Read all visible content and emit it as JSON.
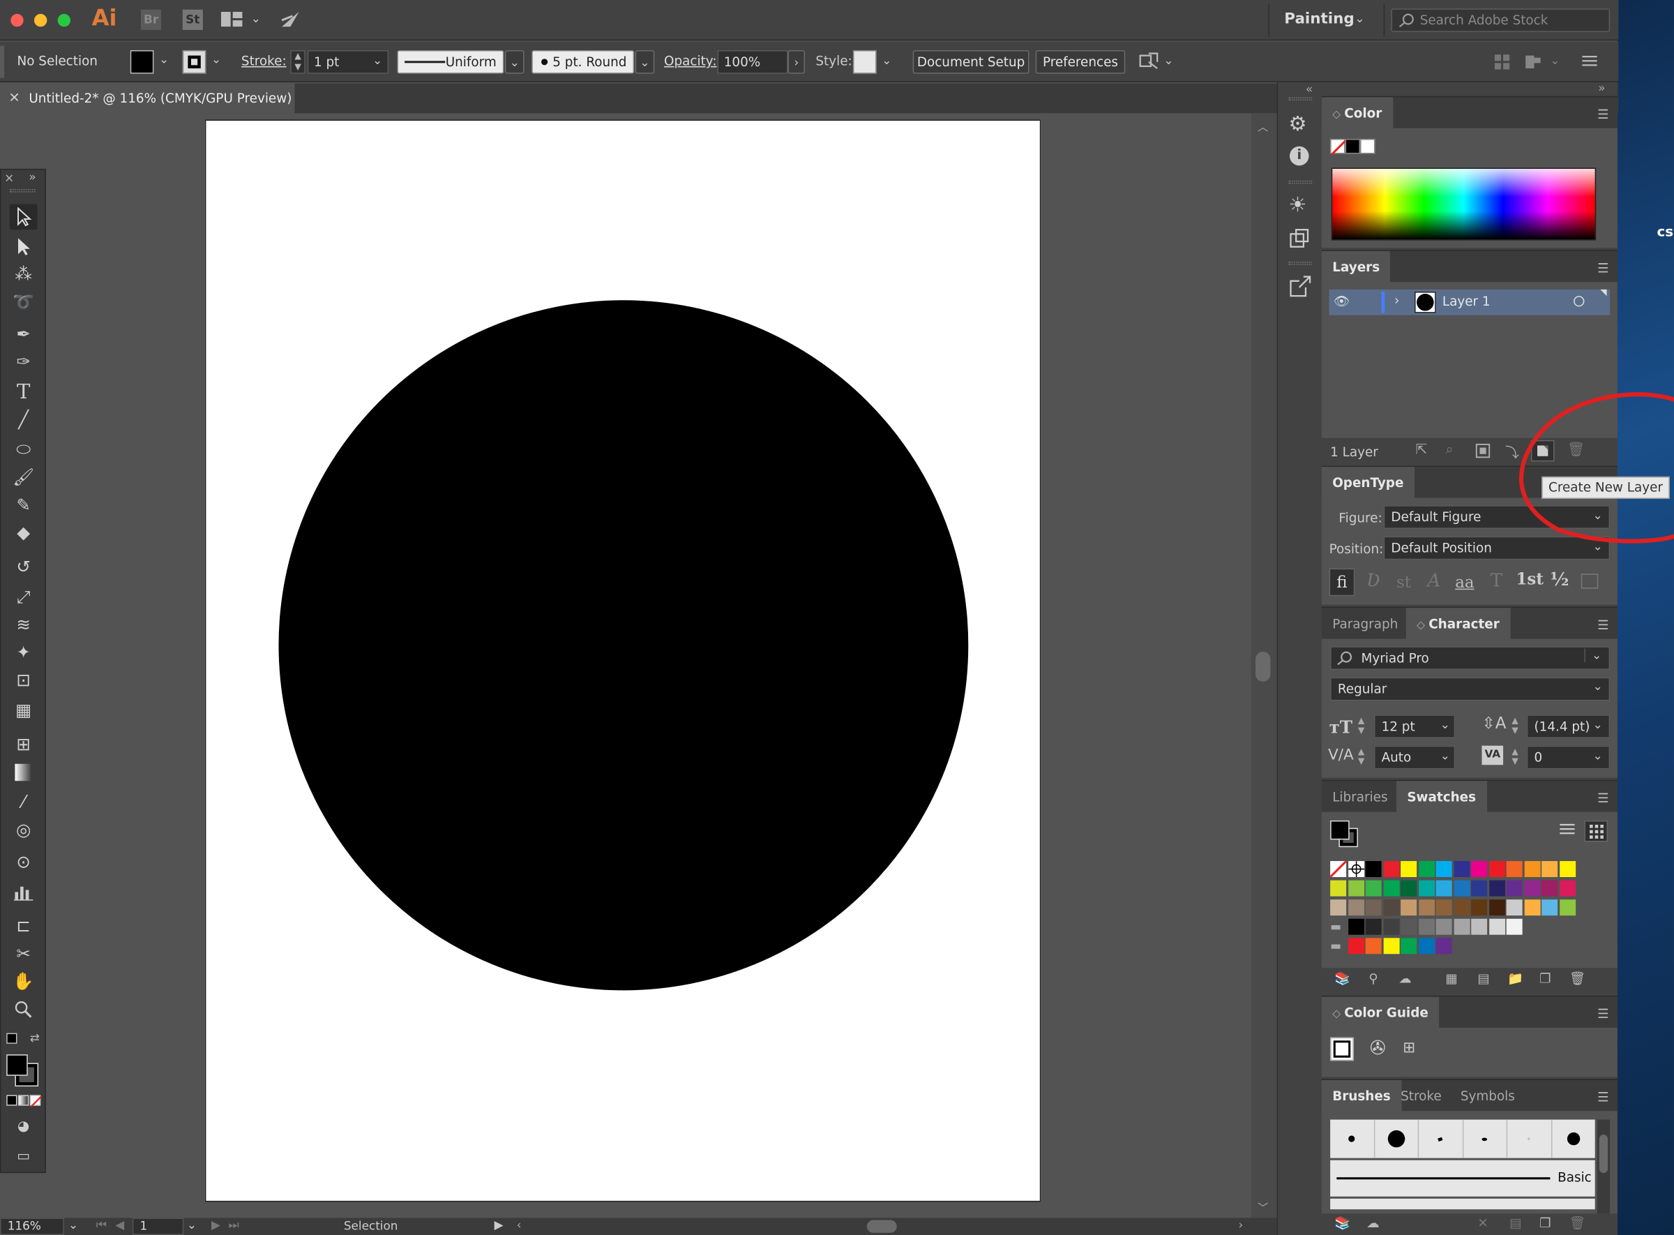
{
  "app": {
    "logo": "Ai",
    "bridge": "Br",
    "stock": "St",
    "workspace": "Painting",
    "search_placeholder": "Search Adobe Stock"
  },
  "control_bar": {
    "selection_status": "No Selection",
    "stroke_label": "Stroke:",
    "stroke_weight": "1 pt",
    "stroke_profile": "Uniform",
    "brush": "5 pt. Round",
    "opacity_label": "Opacity:",
    "opacity": "100%",
    "style_label": "Style:",
    "document_setup": "Document Setup",
    "preferences": "Preferences"
  },
  "document": {
    "tab_title": "Untitled-2* @ 116% (CMYK/GPU Preview)"
  },
  "status_bar": {
    "zoom": "116%",
    "artboard_number": "1",
    "status": "Selection"
  },
  "panels": {
    "color": {
      "title": "Color"
    },
    "layers": {
      "title": "Layers",
      "layer_name": "Layer 1",
      "count": "1 Layer",
      "tooltip": "Create New Layer"
    },
    "opentype": {
      "title": "OpenType",
      "figure_label": "Figure:",
      "figure": "Default Figure",
      "position_label": "Position:",
      "position": "Default Position",
      "glyphs": [
        "fi",
        "Ʋ",
        "st",
        "A",
        "aa",
        "T",
        "1st",
        "½"
      ]
    },
    "character": {
      "tab_paragraph": "Paragraph",
      "tab_character": "Character",
      "font": "Myriad Pro",
      "style": "Regular",
      "size": "12 pt",
      "leading": "(14.4 pt)",
      "kerning": "Auto",
      "tracking": "0"
    },
    "swatches": {
      "tab_libraries": "Libraries",
      "tab_swatches": "Swatches",
      "rows": [
        [
          "#ffffff",
          "#ffffff",
          "#000000",
          "#e8212c",
          "#fff200",
          "#00a651",
          "#00aeef",
          "#2e3192",
          "#ec008c",
          "#ed1c24",
          "#f26522",
          "#f7941d",
          "#fbb040",
          "#fff200"
        ],
        [
          "#d7df23",
          "#8dc63f",
          "#39b54a",
          "#00a651",
          "#006838",
          "#00a99d",
          "#27aae1",
          "#1c75bc",
          "#2b3990",
          "#262262",
          "#662d91",
          "#92278f",
          "#9e1f63",
          "#da1c5c"
        ],
        [
          "#c7b299",
          "#998675",
          "#736357",
          "#534741",
          "#c69c6d",
          "#a67c52",
          "#8c6239",
          "#754c24",
          "#603913",
          "#42210b",
          "#cccccc",
          "#fbb040",
          "#5eb6e4",
          "#8dc63f"
        ],
        [
          "#000000",
          "#262626",
          "#404040",
          "#595959",
          "#737373",
          "#8c8c8c",
          "#a6a6a6",
          "#bfbfbf",
          "#d9d9d9",
          "#f2f2f2"
        ],
        [
          "#ed1c24",
          "#f26522",
          "#fff200",
          "#00a651",
          "#0072bc",
          "#662d91"
        ]
      ]
    },
    "color_guide": {
      "title": "Color Guide"
    },
    "brushes": {
      "tab_brushes": "Brushes",
      "tab_stroke": "Stroke",
      "tab_symbols": "Symbols",
      "basic_label": "Basic"
    }
  },
  "background": {
    "peek_text": "cs"
  }
}
